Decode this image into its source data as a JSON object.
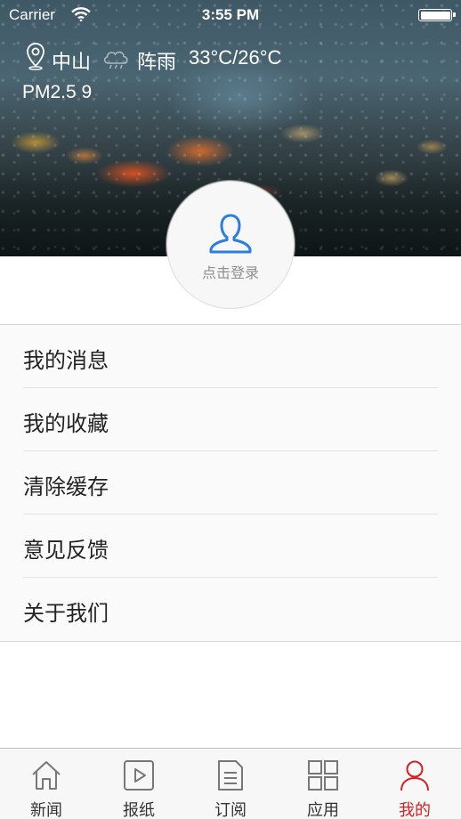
{
  "status_bar": {
    "carrier": "Carrier",
    "time": "3:55 PM"
  },
  "weather": {
    "city": "中山",
    "condition": "阵雨",
    "temperature": "33°C/26°C",
    "pm": "PM2.5  9"
  },
  "profile": {
    "login_label": "点击登录",
    "icon": "user-icon",
    "accent": "#2a7de1"
  },
  "menu": {
    "items": [
      {
        "label": "我的消息"
      },
      {
        "label": "我的收藏"
      },
      {
        "label": "清除缓存"
      },
      {
        "label": "意见反馈"
      },
      {
        "label": "关于我们"
      }
    ]
  },
  "tabbar": {
    "active_color": "#d81e1e",
    "items": [
      {
        "label": "新闻",
        "icon": "home-icon"
      },
      {
        "label": "报纸",
        "icon": "play-icon"
      },
      {
        "label": "订阅",
        "icon": "document-icon"
      },
      {
        "label": "应用",
        "icon": "grid-icon"
      },
      {
        "label": "我的",
        "icon": "person-icon",
        "active": true
      }
    ]
  }
}
